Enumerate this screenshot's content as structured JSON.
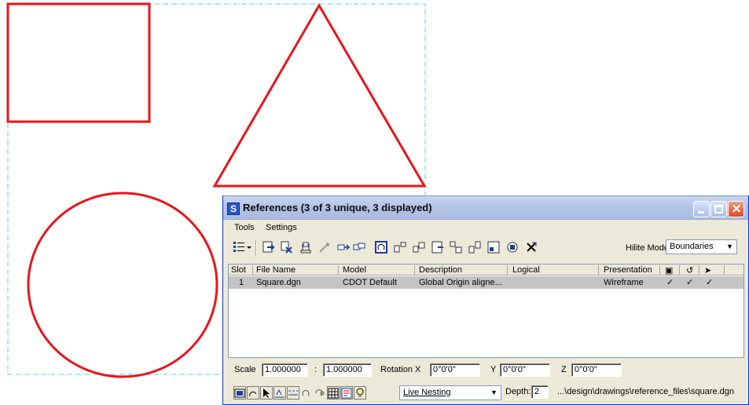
{
  "dialog": {
    "title": "References (3 of 3 unique, 3 displayed)",
    "title_icon": "S",
    "window_buttons": [
      "minimize-icon",
      "maximize-icon",
      "close-icon"
    ]
  },
  "menu": {
    "items": [
      {
        "label": "Tools"
      },
      {
        "label": "Settings"
      }
    ]
  },
  "toolbar": {
    "hilite_label": "Hilite Mode:",
    "hilite_value": "Boundaries",
    "icons": [
      "list-view-icon",
      "attach-icon",
      "detach-icon",
      "reload-icon",
      "exchange-icon",
      "move-icon",
      "copy-icon",
      "rotate-icon",
      "mirror-icon",
      "scale-icon",
      "clip-boundary-icon",
      "clip-mask-icon",
      "clip-front-icon",
      "clip-back-icon",
      "delete-clip-icon",
      "merge-icon",
      "make-direct-icon",
      "settings-icon",
      "cancel-icon"
    ]
  },
  "table": {
    "columns": [
      "Slot",
      "File Name",
      "Model",
      "Description",
      "Logical",
      "Presentation"
    ],
    "flag_icons": [
      "display-icon",
      "snap-icon",
      "locate-icon"
    ],
    "rows": [
      {
        "slot": "1",
        "file_name": "Square.dgn",
        "model": "CDOT Default",
        "description": "Global Origin aligne...",
        "logical": "",
        "presentation": "Wireframe",
        "display": "✓",
        "snap": "✓",
        "locate": "✓"
      }
    ]
  },
  "transform": {
    "scale_label": "Scale",
    "scale_master": "1.000000",
    "scale_separator": ":",
    "scale_ref": "1.000000",
    "rotation_x_label": "Rotation X",
    "rotation_x": "0°0'0\"",
    "y_label": "Y",
    "rotation_y": "0°0'0\"",
    "z_label": "Z",
    "rotation_z": "0°0'0\""
  },
  "bottom": {
    "nesting_value": "Live Nesting",
    "depth_label": "Depth:",
    "depth_value": "2",
    "file_path": "...\\design\\drawings\\reference_files\\square.dgn",
    "icons": [
      "display-toggle-icon",
      "snap-toggle-icon",
      "locate-toggle-icon",
      "level-display-icon",
      "line-style-icon",
      "ignore-attach-icon",
      "treat-as-element-icon",
      "raster-icon",
      "level-symbology-icon",
      "lightbulb-icon"
    ]
  },
  "drawing": {
    "shapes": [
      "square",
      "triangle",
      "circle"
    ],
    "shape_color": "#e8151b",
    "boundary_color": "#4fd0e4"
  },
  "colors": {
    "dialog_bg": "#ece9d8",
    "selected_row": "#c4c4c4",
    "title_bar": "#b4c4e6"
  }
}
